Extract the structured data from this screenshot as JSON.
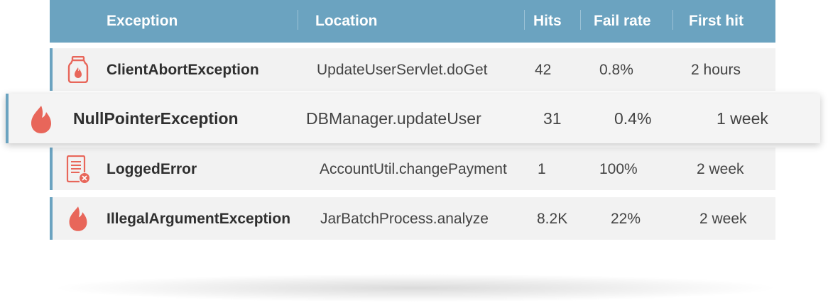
{
  "table": {
    "columns": {
      "exception": "Exception",
      "location": "Location",
      "hits": "Hits",
      "fail_rate": "Fail rate",
      "first_hit": "First hit"
    },
    "rows": [
      {
        "icon": "jar-icon",
        "exception": "ClientAbortException",
        "location": "UpdateUserServlet.doGet",
        "hits": "42",
        "fail_rate": "0.8%",
        "first_hit": "2 hours"
      },
      {
        "icon": "flame-icon",
        "exception": "NullPointerException",
        "location": "DBManager.updateUser",
        "hits": "31",
        "fail_rate": "0.4%",
        "first_hit": "1 week"
      },
      {
        "icon": "log-error-icon",
        "exception": "LoggedError",
        "location": "AccountUtil.changePayment",
        "hits": "1",
        "fail_rate": "100%",
        "first_hit": "2 week"
      },
      {
        "icon": "flame-icon",
        "exception": "IllegalArgumentException",
        "location": "JarBatchProcess.analyze",
        "hits": "8.2K",
        "fail_rate": "22%",
        "first_hit": "2 week"
      }
    ]
  },
  "colors": {
    "header_bg": "#6ba3c0",
    "row_bg": "#f2f2f2",
    "icon_red": "#e8665a",
    "row_accent": "#6ba3c0"
  }
}
